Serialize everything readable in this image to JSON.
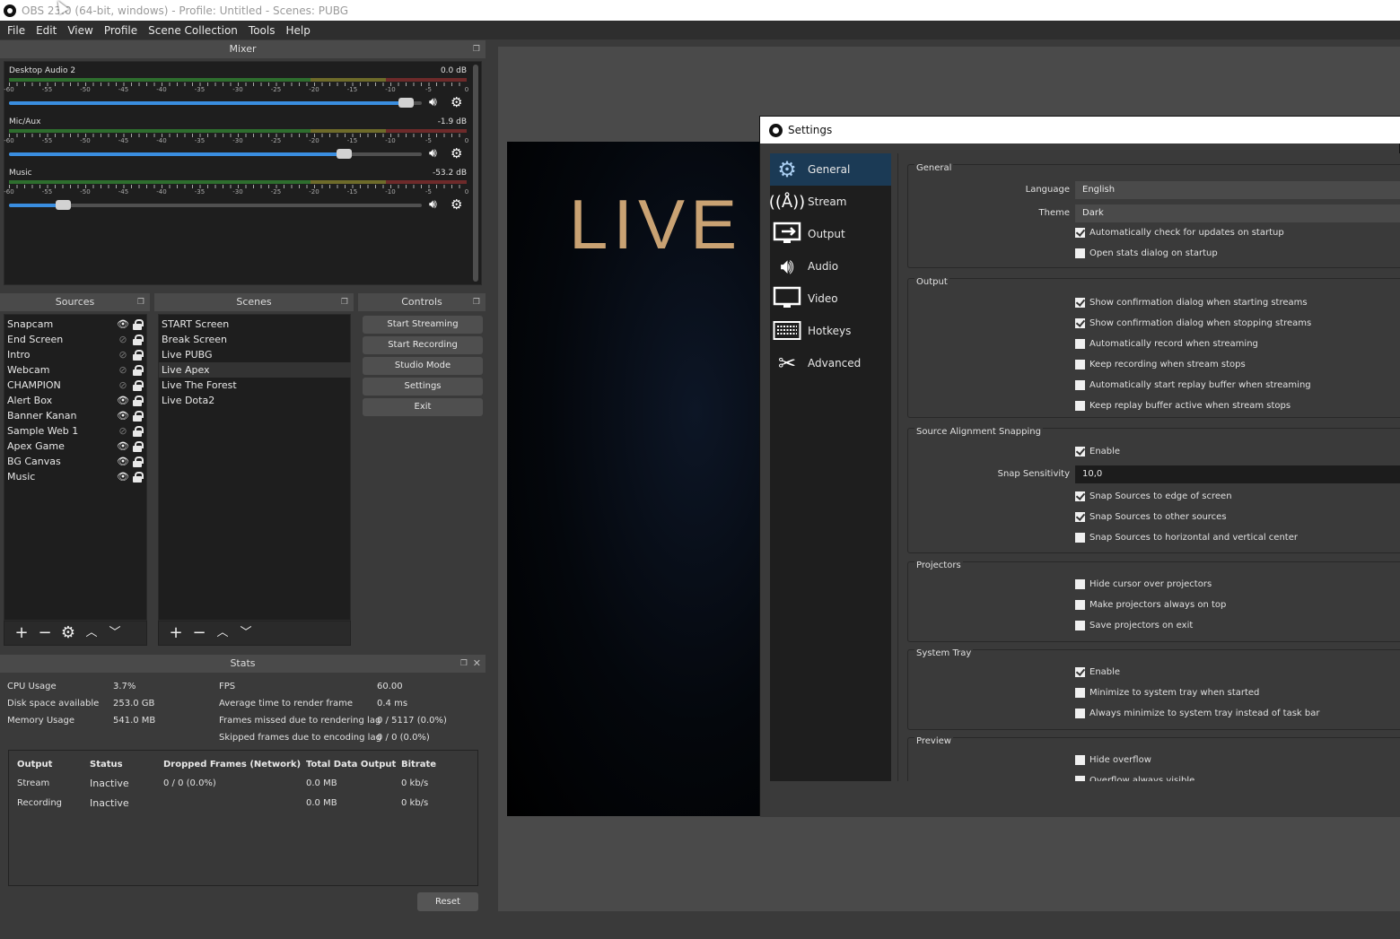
{
  "window": {
    "title": "OBS 23.0 (64-bit, windows) - Profile: Untitled - Scenes: PUBG"
  },
  "menu": [
    "File",
    "Edit",
    "View",
    "Profile",
    "Scene Collection",
    "Tools",
    "Help"
  ],
  "mixer": {
    "title": "Mixer",
    "scale_labels": [
      "-60",
      "-55",
      "-50",
      "-45",
      "-40",
      "-35",
      "-30",
      "-25",
      "-20",
      "-15",
      "-10",
      "-5",
      "0"
    ],
    "channels": [
      {
        "name": "Desktop Audio 2",
        "db": "0.0 dB",
        "volume": 0.96
      },
      {
        "name": "Mic/Aux",
        "db": "-1.9 dB",
        "volume": 0.81
      },
      {
        "name": "Music",
        "db": "-53.2 dB",
        "volume": 0.13
      }
    ],
    "colors": {
      "green": "#2e6e2e",
      "yellow": "#6e6b2a",
      "red": "#6e2a2a",
      "fader": "#3a8ee0"
    }
  },
  "sources": {
    "title": "Sources",
    "items": [
      {
        "name": "Snapcam",
        "visible": true
      },
      {
        "name": "End Screen",
        "visible": false
      },
      {
        "name": "Intro",
        "visible": false
      },
      {
        "name": "Webcam",
        "visible": false
      },
      {
        "name": "CHAMPION",
        "visible": false
      },
      {
        "name": "Alert Box",
        "visible": true
      },
      {
        "name": "Banner Kanan",
        "visible": true
      },
      {
        "name": "Sample Web 1",
        "visible": false
      },
      {
        "name": "Apex Game",
        "visible": true
      },
      {
        "name": "BG Canvas",
        "visible": true
      },
      {
        "name": "Music",
        "visible": true
      }
    ]
  },
  "scenes": {
    "title": "Scenes",
    "items": [
      "START Screen",
      "Break Screen",
      "Live PUBG",
      "Live Apex",
      "Live The Forest",
      "Live Dota2"
    ],
    "selected": "Live Apex"
  },
  "controls": {
    "title": "Controls",
    "buttons": [
      "Start Streaming",
      "Start Recording",
      "Studio Mode",
      "Settings",
      "Exit"
    ]
  },
  "stats": {
    "title": "Stats",
    "left": [
      {
        "label": "CPU Usage",
        "value": "3.7%"
      },
      {
        "label": "Disk space available",
        "value": "253.0 GB"
      },
      {
        "label": "Memory Usage",
        "value": "541.0 MB"
      }
    ],
    "right": [
      {
        "label": "FPS",
        "value": "60.00"
      },
      {
        "label": "Average time to render frame",
        "value": "0.4 ms"
      },
      {
        "label": "Frames missed due to rendering lag",
        "value": "0 / 5117 (0.0%)"
      },
      {
        "label": "Skipped frames due to encoding lag",
        "value": "0 / 0 (0.0%)"
      }
    ],
    "table": {
      "headers": [
        "Output",
        "Status",
        "Dropped Frames (Network)",
        "Total Data Output",
        "Bitrate"
      ],
      "rows": [
        [
          "Stream",
          "Inactive",
          "0 / 0 (0.0%)",
          "0.0 MB",
          "0 kb/s"
        ],
        [
          "Recording",
          "Inactive",
          "",
          "0.0 MB",
          "0 kb/s"
        ]
      ]
    },
    "reset_label": "Reset"
  },
  "preview": {
    "text": "LIVE S"
  },
  "settings": {
    "title": "Settings",
    "nav": [
      {
        "label": "General",
        "icon": "gear-icon",
        "selected": true
      },
      {
        "label": "Stream",
        "icon": "antenna-icon"
      },
      {
        "label": "Output",
        "icon": "monitor-arrow-icon"
      },
      {
        "label": "Audio",
        "icon": "speaker-icon"
      },
      {
        "label": "Video",
        "icon": "monitor-icon"
      },
      {
        "label": "Hotkeys",
        "icon": "keyboard-icon"
      },
      {
        "label": "Advanced",
        "icon": "tools-icon"
      }
    ],
    "general": {
      "title": "General",
      "language_label": "Language",
      "language_value": "English",
      "theme_label": "Theme",
      "theme_value": "Dark",
      "checks": [
        {
          "label": "Automatically check for updates on startup",
          "checked": true
        },
        {
          "label": "Open stats dialog on startup",
          "checked": false
        }
      ]
    },
    "output": {
      "title": "Output",
      "checks": [
        {
          "label": "Show confirmation dialog when starting streams",
          "checked": true
        },
        {
          "label": "Show confirmation dialog when stopping streams",
          "checked": true
        },
        {
          "label": "Automatically record when streaming",
          "checked": false
        },
        {
          "label": "Keep recording when stream stops",
          "checked": false
        },
        {
          "label": "Automatically start replay buffer when streaming",
          "checked": false
        },
        {
          "label": "Keep replay buffer active when stream stops",
          "checked": false
        }
      ]
    },
    "snapping": {
      "title": "Source Alignment Snapping",
      "enable": {
        "label": "Enable",
        "checked": true
      },
      "sensitivity_label": "Snap Sensitivity",
      "sensitivity_value": "10,0",
      "checks": [
        {
          "label": "Snap Sources to edge of screen",
          "checked": true
        },
        {
          "label": "Snap Sources to other sources",
          "checked": true
        },
        {
          "label": "Snap Sources to horizontal and vertical center",
          "checked": false
        }
      ]
    },
    "projectors": {
      "title": "Projectors",
      "checks": [
        {
          "label": "Hide cursor over projectors",
          "checked": false
        },
        {
          "label": "Make projectors always on top",
          "checked": false
        },
        {
          "label": "Save projectors on exit",
          "checked": false
        }
      ]
    },
    "tray": {
      "title": "System Tray",
      "checks": [
        {
          "label": "Enable",
          "checked": true
        },
        {
          "label": "Minimize to system tray when started",
          "checked": false
        },
        {
          "label": "Always minimize to system tray instead of task bar",
          "checked": false
        }
      ]
    },
    "preview": {
      "title": "Preview",
      "checks": [
        {
          "label": "Hide overflow",
          "checked": false
        },
        {
          "label": "Overflow always visible",
          "checked": false
        }
      ]
    }
  }
}
